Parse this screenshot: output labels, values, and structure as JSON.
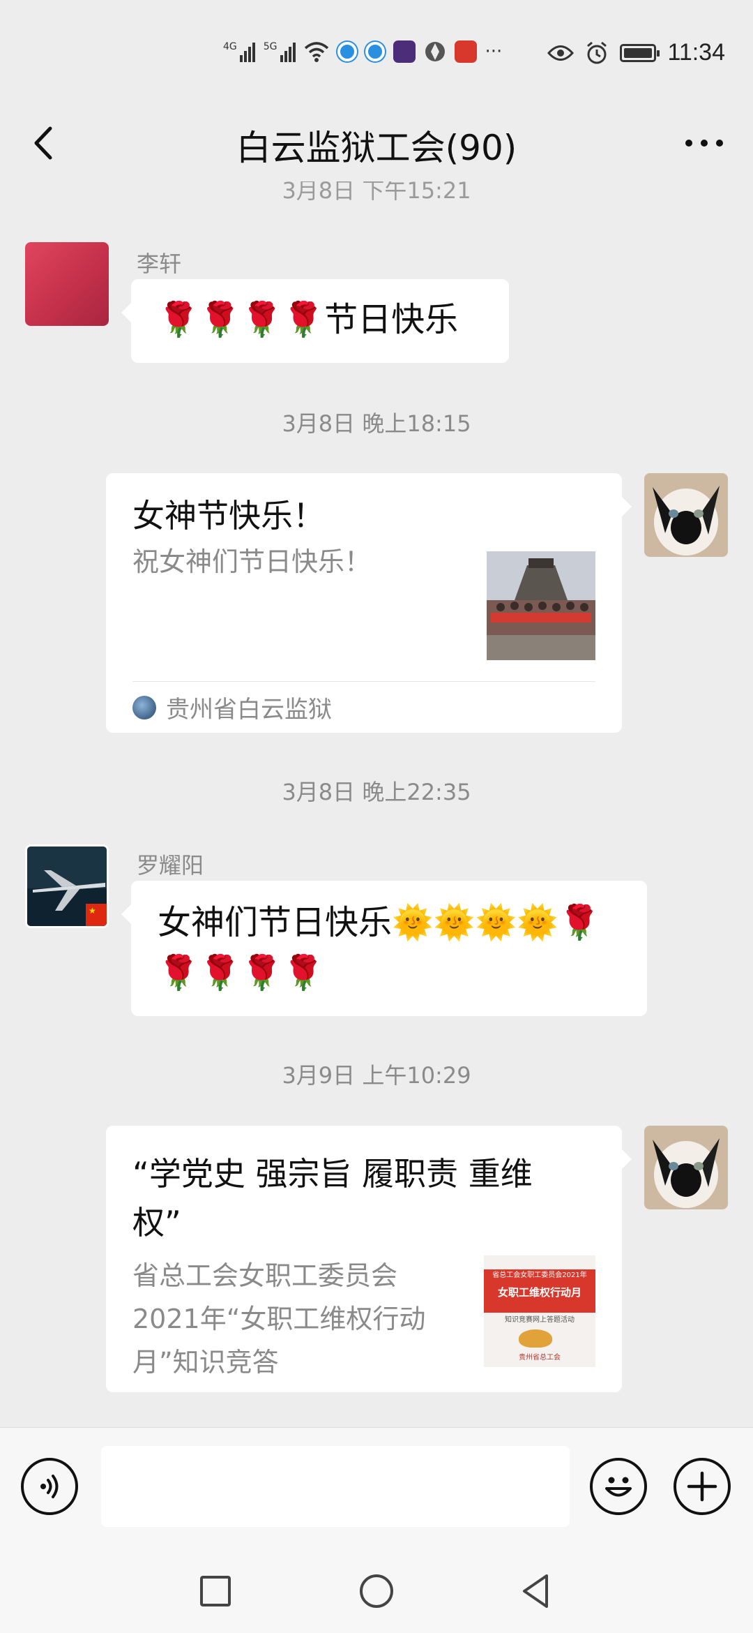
{
  "status_bar": {
    "signal1_label": "4G",
    "signal2_label": "5G",
    "more": "···",
    "time": "11:34"
  },
  "title_bar": {
    "title": "白云监狱工会(90)"
  },
  "chat": {
    "partial_timestamp": "3月8日 下午15:21",
    "messages": [
      {
        "sender": "李轩",
        "text": "🌹🌹🌹🌹节日快乐"
      },
      {
        "timestamp": "3月8日 晚上18:15"
      },
      {
        "card_title": "女神节快乐！",
        "card_desc": "祝女神们节日快乐！",
        "card_source": "贵州省白云监狱"
      },
      {
        "timestamp": "3月8日 晚上22:35"
      },
      {
        "sender": "罗耀阳",
        "text_line1": "女神们节日快乐🌞🌞🌞🌞🌹",
        "text_line2": "🌹🌹🌹🌹"
      },
      {
        "timestamp": "3月9日 上午10:29"
      },
      {
        "card_title": "“学党史 强宗旨 履职责 重维权”",
        "card_desc": "省总工会女职工委员会2021年“女职工维权行动月”知识竞答",
        "thumb_top": "省总工会女职工委员会2021年",
        "thumb_main": "女职工维权行动月",
        "thumb_sub": "知识竞赛网上答题活动",
        "thumb_footer": "贵州省总工会"
      }
    ]
  },
  "colors": {
    "background": "#ededed",
    "bubble": "#ffffff",
    "timestamp": "#8a8a8a",
    "thumb_red": "#d8382c"
  },
  "icons": {
    "back": "chevron-left-icon",
    "more": "more-dots-icon",
    "voice": "voice-icon",
    "emoji": "emoji-icon",
    "plus": "plus-icon",
    "nav_recents": "square-icon",
    "nav_home": "circle-icon",
    "nav_back": "triangle-back-icon"
  }
}
